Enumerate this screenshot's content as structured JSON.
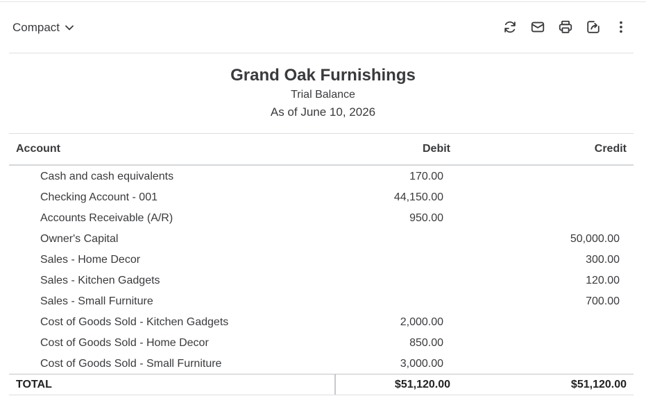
{
  "toolbar": {
    "view_label": "Compact",
    "actions": [
      "refresh-icon",
      "email-icon",
      "print-icon",
      "export-icon",
      "more-icon"
    ]
  },
  "report": {
    "company": "Grand Oak Furnishings",
    "title": "Trial Balance",
    "date": "As of June 10, 2026"
  },
  "table": {
    "headers": {
      "account": "Account",
      "debit": "Debit",
      "credit": "Credit"
    },
    "rows": [
      {
        "account": "Cash and cash equivalents",
        "debit": "170.00",
        "credit": ""
      },
      {
        "account": "Checking Account - 001",
        "debit": "44,150.00",
        "credit": ""
      },
      {
        "account": "Accounts Receivable (A/R)",
        "debit": "950.00",
        "credit": ""
      },
      {
        "account": "Owner's Capital",
        "debit": "",
        "credit": "50,000.00"
      },
      {
        "account": "Sales - Home Decor",
        "debit": "",
        "credit": "300.00"
      },
      {
        "account": "Sales - Kitchen Gadgets",
        "debit": "",
        "credit": "120.00"
      },
      {
        "account": "Sales - Small Furniture",
        "debit": "",
        "credit": "700.00"
      },
      {
        "account": "Cost of Goods Sold - Kitchen Gadgets",
        "debit": "2,000.00",
        "credit": ""
      },
      {
        "account": "Cost of Goods Sold - Home Decor",
        "debit": "850.00",
        "credit": ""
      },
      {
        "account": "Cost of Goods Sold - Small Furniture",
        "debit": "3,000.00",
        "credit": ""
      }
    ],
    "total": {
      "label": "TOTAL",
      "debit": "$51,120.00",
      "credit": "$51,120.00"
    }
  }
}
